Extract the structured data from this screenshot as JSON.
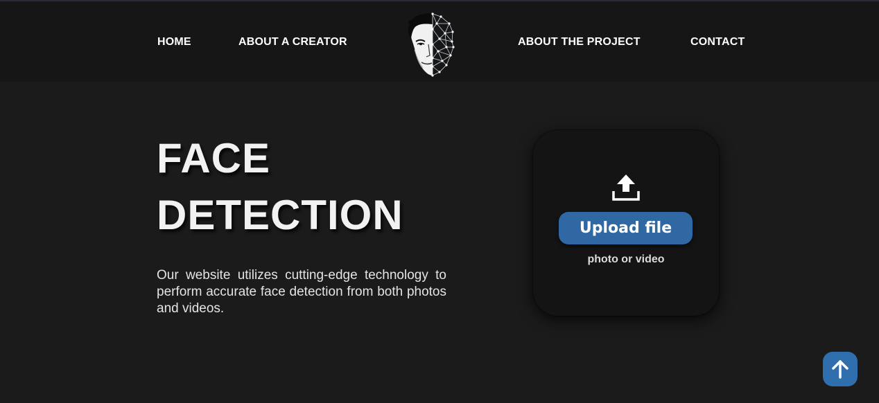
{
  "nav": {
    "home": "HOME",
    "about_creator": "ABOUT A CREATOR",
    "about_project": "ABOUT THE PROJECT",
    "contact": "CONTACT"
  },
  "hero": {
    "title_line1": "FACE",
    "title_line2": "DETECTION",
    "description": "Our website utilizes cutting-edge technology to perform accurate face detection from both photos and videos."
  },
  "upload": {
    "icon": "upload-icon",
    "button_label": "Upload file",
    "subtitle": "photo or video"
  },
  "scroll_top": {
    "icon": "arrow-up-icon"
  },
  "colors": {
    "background": "#1b1b1c",
    "header": "#161616",
    "card": "#141414",
    "accent": "#2f68a3"
  }
}
